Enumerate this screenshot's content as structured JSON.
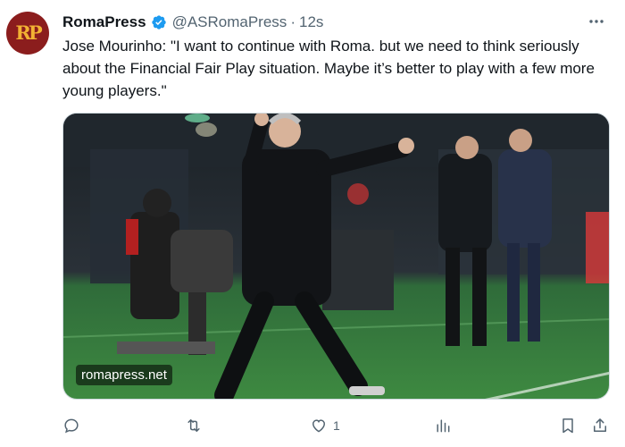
{
  "tweet": {
    "display_name": "RomaPress",
    "handle": "@ASRomaPress",
    "separator": "·",
    "timestamp": "12s",
    "text": "Jose Mourinho: \"I want to continue with Roma. but we need to think seriously about the Financial Fair Play situation. Maybe it’s better to play with a few more young players.\"",
    "avatar_text": "RP",
    "verified_color": "#1d9bf0",
    "brand_color": "#8b1d1d"
  },
  "media": {
    "watermark": "romapress.net"
  },
  "actions": {
    "reply_count": "",
    "retweet_count": "",
    "like_count": "1",
    "views_count": ""
  }
}
